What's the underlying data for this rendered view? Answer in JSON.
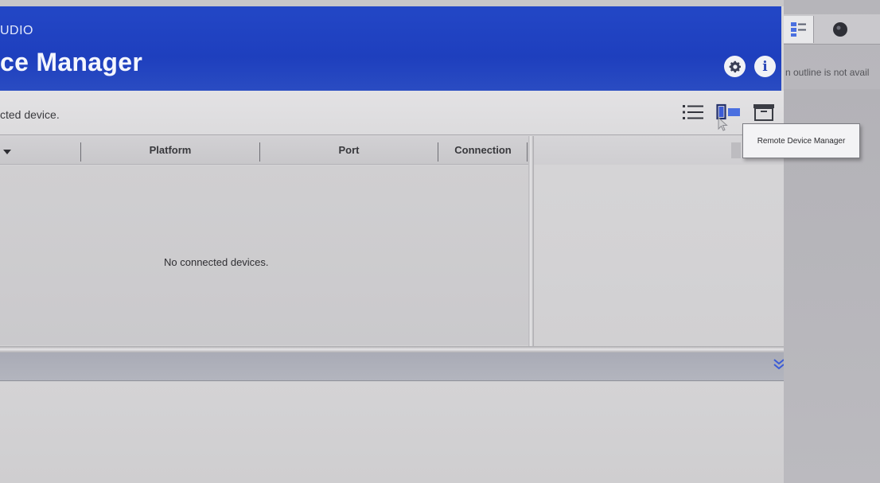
{
  "header": {
    "subtitle": "UDIO",
    "title": "ce Manager"
  },
  "toolbar": {
    "status_text": "cted device."
  },
  "table": {
    "columns": [
      "",
      "Platform",
      "Port",
      "Connection"
    ],
    "empty_message": "No connected devices."
  },
  "tooltip": {
    "text": "Remote Device Manager"
  },
  "side_panel": {
    "message": "n outline is not avail"
  },
  "colors": {
    "header_blue": "#1e3fbe",
    "accent_blue": "#3b5bd6"
  },
  "icons": [
    "settings-gear-icon",
    "info-icon",
    "list-view-icon",
    "split-view-icon",
    "archive-icon",
    "double-chevron-down-icon",
    "outline-icon",
    "dark-circle-icon"
  ]
}
